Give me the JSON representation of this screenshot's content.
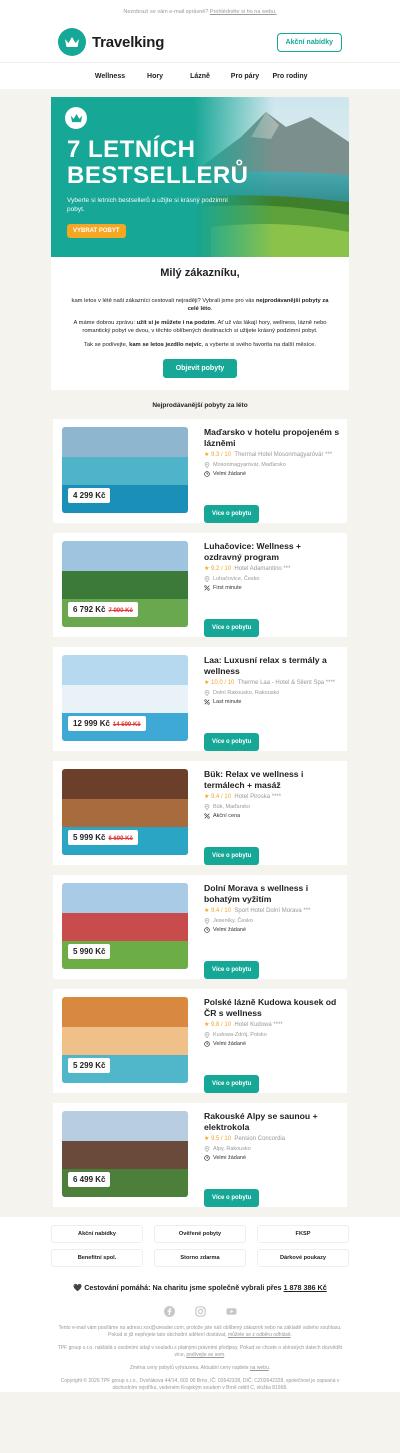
{
  "top_note": {
    "text": "Nezobrazí se vám e-mail správně?",
    "link": "Prohlédněte si ho na webu."
  },
  "brand": {
    "name": "Travelking",
    "accent": "#17a796",
    "orange": "#f5a623"
  },
  "header": {
    "cta": "Akční nabídky"
  },
  "nav": [
    "Wellness",
    "Hory",
    "Lázně",
    "Pro páry",
    "Pro rodiny"
  ],
  "hero": {
    "title_line1": "7 LETNÍCH",
    "title_line2": "BESTSELLERŮ",
    "subtitle": "Vyberte si letních bestsellerů a užijte si krásný podzimní pobyt.",
    "button": "VYBRAT POBYT"
  },
  "greeting": {
    "title": "Milý zákazníku,",
    "p1_a": "kam letos v létě naši zákazníci cestovali nejraději? Vybrali jsme pro vás ",
    "p1_b": "nejprodávanější pobyty za celé léto",
    "p1_c": ".",
    "p2_a": "A máme dobrou zprávu: ",
    "p2_b": "užít si je můžete i na podzim",
    "p2_c": ". Ať už vás lákají hory, wellness, lázně nebo romantický pobyt ve dvou, v těchto oblíbených destinacích si užijete krásný podzimní pobyt.",
    "p3_a": "Tak se podívejte, ",
    "p3_b": "kam se letos jezdilo nejvíc",
    "p3_c": ", a vyberte si svého favorita na další měsíce.",
    "button": "Objevit pobyty"
  },
  "section_title": "Nejprodávanější pobyty za léto",
  "cards": [
    {
      "title": "Maďarsko v hotelu propojeném s lázněmi",
      "score": "★ 9.3 / 10",
      "hotel": "Thermal Hotel Mosonmagyaróvár ***",
      "location": "Mosonmagyaróvár, Maďarsko",
      "tag": "Velmi žádané",
      "tag_icon": "clock-icon",
      "price": "4 299 Kč",
      "old_price": "",
      "button": "Více o pobytu"
    },
    {
      "title": "Luhačovice: Wellness + ozdravný program",
      "score": "★ 9.2 / 10",
      "hotel": "Hotel Adamantino ***",
      "location": "Luhačovice, Česko",
      "tag": "First minute",
      "tag_icon": "percent-icon",
      "price": "6 792 Kč",
      "old_price": "7 990 Kč",
      "button": "Více o pobytu"
    },
    {
      "title": "Laa: Luxusní relax s termály a wellness",
      "score": "★ 10.0 / 10",
      "hotel": "Therme Laa - Hotel & Silent Spa ****",
      "location": "Dolní Rakousko, Rakousko",
      "tag": "Last minute",
      "tag_icon": "percent-icon",
      "price": "12 999 Kč",
      "old_price": "14 599 Kč",
      "button": "Více o pobytu"
    },
    {
      "title": "Bük: Relax ve wellness i termálech + masáž",
      "score": "★ 9.4 / 10",
      "hotel": "Hotel Piroska ****",
      "location": "Bük, Maďarsko",
      "tag": "Akční cena",
      "tag_icon": "percent-icon",
      "price": "5 999 Kč",
      "old_price": "6 699 Kč",
      "button": "Více o pobytu"
    },
    {
      "title": "Dolní Morava s wellness i bohatým vyžitím",
      "score": "★ 9.4 / 10",
      "hotel": "Sport Hotel Dolní Morava ***",
      "location": "Jeseníky, Česko",
      "tag": "Velmi žádané",
      "tag_icon": "clock-icon",
      "price": "5 990 Kč",
      "old_price": "",
      "button": "Více o pobytu"
    },
    {
      "title": "Polské lázně Kudowa kousek od ČR s wellness",
      "score": "★ 9.8 / 10",
      "hotel": "Hotel Kudowa ****",
      "location": "Kudowa-Zdrój, Polsko",
      "tag": "Velmi žádané",
      "tag_icon": "clock-icon",
      "price": "5 299 Kč",
      "old_price": "",
      "button": "Více o pobytu"
    },
    {
      "title": "Rakouské Alpy se saunou + elektrokola",
      "score": "★ 9.5 / 10",
      "hotel": "Pension Concordia",
      "location": "Alpy, Rakousko",
      "tag": "Velmi žádané",
      "tag_icon": "clock-icon",
      "price": "6 499 Kč",
      "old_price": "",
      "button": "Více o pobytu"
    }
  ],
  "footer_links": [
    [
      "Akční nabídky",
      "Ověřené pobyty",
      "FKSP"
    ],
    [
      "Benefitní spol.",
      "Storno zdarma",
      "Dárkové poukazy"
    ]
  ],
  "charity": {
    "text": "🖤 Cestování pomáhá: Na charitu jsme společně vybrali přes ",
    "amount": "1 878 386 Kč"
  },
  "social": [
    "facebook-icon",
    "instagram-icon",
    "youtube-icon"
  ],
  "legal": {
    "p1": "Tento e-mail vám posíláme na adresu xxx@ureader.com, protože jste náš oblíbený zákazník nebo na základě vašeho souhlasu. Pokud si již nepřejete tato obchodní sdělení dostávat, ",
    "p1_link": "můžete se z odběru odhlásit",
    "p2": "TPF group s.r.o. nakládá s osobními údaji v souladu s platnými právními předpisy. Pokud se chcete o sbíraných datech dozvědět více, ",
    "p2_link": "podívejte se sem",
    "p3": "Změna ceny pobytů vyhrazena. Aktuální ceny najdete ",
    "p3_link": "na webu",
    "p4": "Copyright © 2026 TPF group s.r.o., Dvořákova 44/14, 602 00 Brno, IČ: 02642328, DIČ: CZ02642328, společnost je zapsaná v obchodním rejstříku, vedeném Krajským soudem v Brně oddíl C, vložka 81968."
  }
}
